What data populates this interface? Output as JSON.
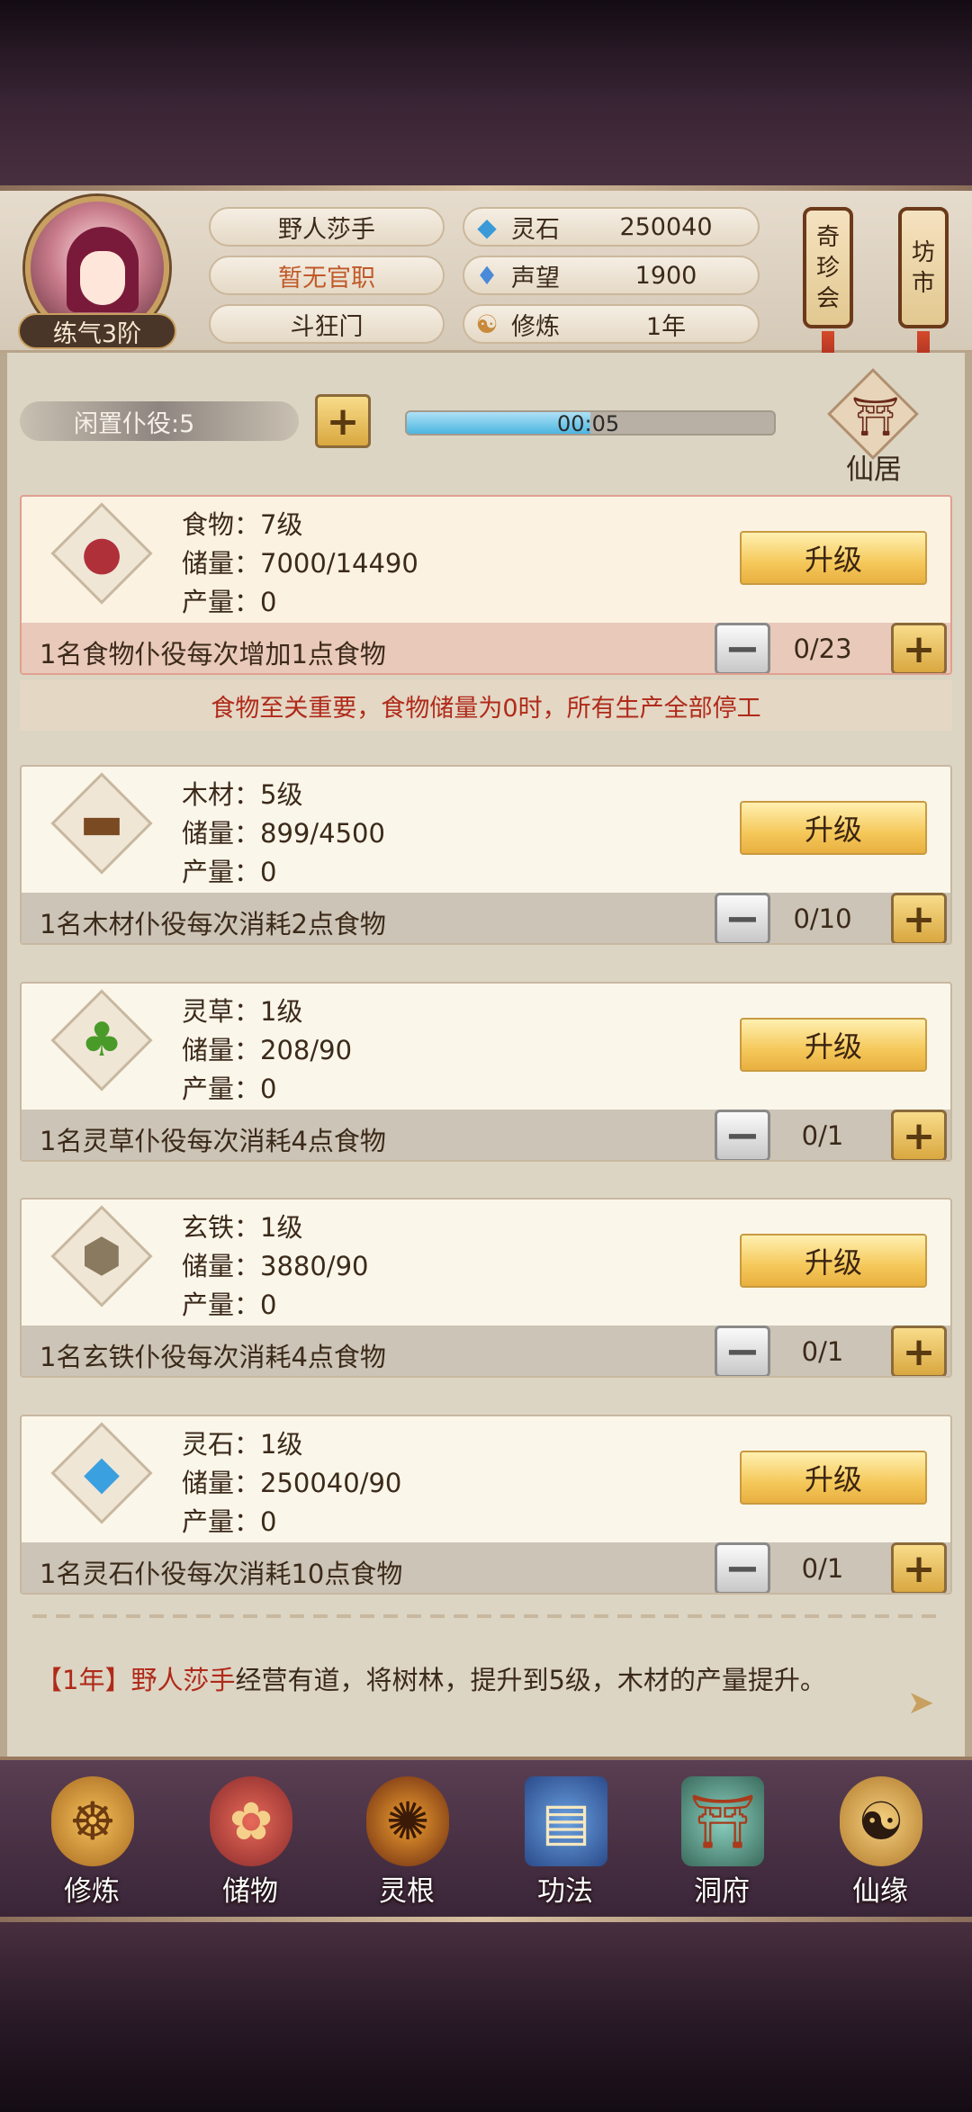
{
  "profile": {
    "name": "野人莎手",
    "official_title": "暂无官职",
    "sect": "斗狂门",
    "rank": "练气3阶",
    "stats": [
      {
        "label": "灵石",
        "value": "250040",
        "icon": "spirit-stone-icon"
      },
      {
        "label": "声望",
        "value": "1900",
        "icon": "prestige-crystal-icon"
      },
      {
        "label": "修炼",
        "value": "1年",
        "icon": "meditation-icon"
      }
    ]
  },
  "lanterns": [
    {
      "label": "奇珍会",
      "chars": [
        "奇",
        "珍",
        "会"
      ]
    },
    {
      "label": "坊市",
      "chars": [
        "坊",
        "市"
      ]
    }
  ],
  "workers": {
    "idle_label": "闲置仆役:5",
    "timer": "00:05",
    "progress": 0.5
  },
  "residence": {
    "label": "仙居"
  },
  "resources": [
    {
      "name": "食物：7级",
      "storage": "储量：7000/14490",
      "output": "产量：0",
      "desc": "1名食物仆役每次增加1点食物",
      "count": "0/23",
      "upgrade": "升级",
      "icon": "meat-icon"
    },
    {
      "name": "木材：5级",
      "storage": "储量：899/4500",
      "output": "产量：0",
      "desc": "1名木材仆役每次消耗2点食物",
      "count": "0/10",
      "upgrade": "升级",
      "icon": "wood-logs-icon"
    },
    {
      "name": "灵草：1级",
      "storage": "储量：208/90",
      "output": "产量：0",
      "desc": "1名灵草仆役每次消耗4点食物",
      "count": "0/1",
      "upgrade": "升级",
      "icon": "herb-icon"
    },
    {
      "name": "玄铁：1级",
      "storage": "储量：3880/90",
      "output": "产量：0",
      "desc": "1名玄铁仆役每次消耗4点食物",
      "count": "0/1",
      "upgrade": "升级",
      "icon": "iron-ore-icon"
    },
    {
      "name": "灵石：1级",
      "storage": "储量：250040/90",
      "output": "产量：0",
      "desc": "1名灵石仆役每次消耗10点食物",
      "count": "0/1",
      "upgrade": "升级",
      "icon": "spirit-crystal-icon"
    }
  ],
  "food_warning": "食物至关重要，食物储量为0时，所有生产全部停工",
  "log": {
    "year": "【1年】",
    "actor": "野人莎手",
    "message": "经营有道，将树林，提升到5级，木材的产量提升。"
  },
  "nav": [
    {
      "label": "修炼",
      "icon": "cultivation-monk-icon"
    },
    {
      "label": "储物",
      "icon": "storage-bag-icon"
    },
    {
      "label": "灵根",
      "icon": "spirit-root-icon"
    },
    {
      "label": "功法",
      "icon": "technique-book-icon"
    },
    {
      "label": "洞府",
      "icon": "cave-dwelling-icon"
    },
    {
      "label": "仙缘",
      "icon": "immortal-fate-icon"
    }
  ],
  "colors": {
    "accent_gold": "#f5c85a",
    "warning_red": "#b02a1a",
    "progress_blue": "#4cb6e0"
  }
}
